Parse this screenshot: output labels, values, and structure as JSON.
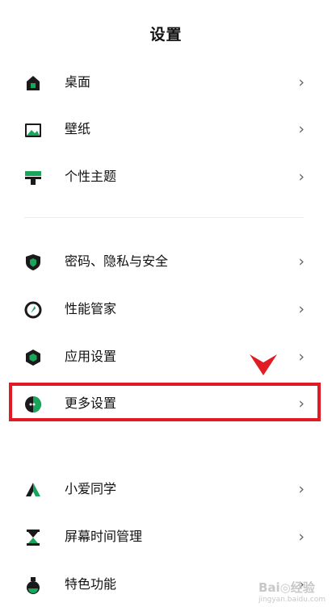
{
  "header": {
    "title": "设置"
  },
  "groups": [
    {
      "items": [
        {
          "label": "桌面",
          "icon": "home-icon"
        },
        {
          "label": "壁纸",
          "icon": "wallpaper-icon"
        },
        {
          "label": "个性主题",
          "icon": "theme-icon"
        }
      ]
    },
    {
      "items": [
        {
          "label": "密码、隐私与安全",
          "icon": "shield-icon"
        },
        {
          "label": "性能管家",
          "icon": "performance-icon"
        },
        {
          "label": "应用设置",
          "icon": "app-settings-icon"
        },
        {
          "label": "更多设置",
          "icon": "more-settings-icon"
        }
      ]
    },
    {
      "items": [
        {
          "label": "小爱同学",
          "icon": "xiaoai-icon"
        },
        {
          "label": "屏幕时间管理",
          "icon": "hourglass-icon"
        },
        {
          "label": "特色功能",
          "icon": "flask-icon"
        }
      ]
    }
  ],
  "chevron": "›",
  "colors": {
    "accent": "#1aa65a",
    "dark": "#1a1a1a",
    "highlight": "#e01b24"
  },
  "watermark": {
    "text": "Bai◎经验",
    "sub": "jingyan.baidu.com"
  }
}
